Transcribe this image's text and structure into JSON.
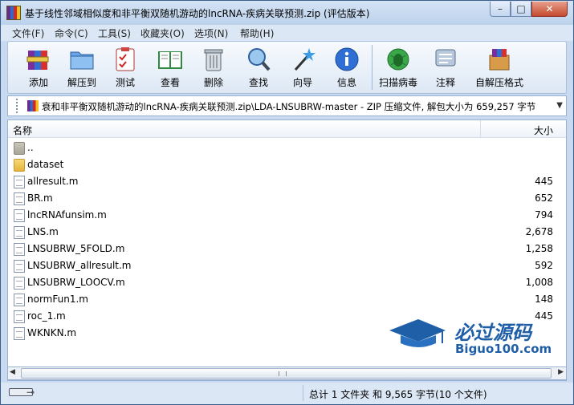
{
  "window": {
    "title": "基于线性邻域相似度和非平衡双随机游动的lncRNA-疾病关联预测.zip (评估版本)"
  },
  "title_buttons": {
    "minimize": "–",
    "maximize": "□",
    "close": "✕"
  },
  "menu": {
    "items": [
      "文件(F)",
      "命令(C)",
      "工具(S)",
      "收藏夹(O)",
      "选项(N)",
      "帮助(H)"
    ]
  },
  "toolbar": {
    "items": [
      {
        "label": "添加",
        "icon": "add-archive-icon"
      },
      {
        "label": "解压到",
        "icon": "extract-folder-icon"
      },
      {
        "label": "测试",
        "icon": "test-clipboard-icon"
      },
      {
        "label": "查看",
        "icon": "view-book-icon"
      },
      {
        "label": "删除",
        "icon": "trash-icon"
      },
      {
        "label": "查找",
        "icon": "magnifier-icon"
      },
      {
        "label": "向导",
        "icon": "wizard-wand-icon"
      },
      {
        "label": "信息",
        "icon": "info-icon"
      },
      {
        "label": "扫描病毒",
        "icon": "virus-scan-icon"
      },
      {
        "label": "注释",
        "icon": "comment-icon"
      },
      {
        "label": "自解压格式",
        "icon": "sfx-box-icon"
      }
    ]
  },
  "pathbar": {
    "text": "衰和非平衡双随机游动的lncRNA-疾病关联预测.zip\\LDA-LNSUBRW-master - ZIP 压缩文件, 解包大小为 659,257 字节",
    "dropdown": "▼"
  },
  "filelist": {
    "columns": {
      "name": "名称",
      "size": "大小"
    },
    "rows": [
      {
        "name": "..",
        "size": "",
        "type": "up"
      },
      {
        "name": "dataset",
        "size": "",
        "type": "folder"
      },
      {
        "name": "allresult.m",
        "size": "445",
        "type": "file"
      },
      {
        "name": "BR.m",
        "size": "652",
        "type": "file"
      },
      {
        "name": "lncRNAfunsim.m",
        "size": "794",
        "type": "file"
      },
      {
        "name": "LNS.m",
        "size": "2,678",
        "type": "file"
      },
      {
        "name": "LNSUBRW_5FOLD.m",
        "size": "1,258",
        "type": "file"
      },
      {
        "name": "LNSUBRW_allresult.m",
        "size": "592",
        "type": "file"
      },
      {
        "name": "LNSUBRW_LOOCV.m",
        "size": "1,008",
        "type": "file"
      },
      {
        "name": "normFun1.m",
        "size": "148",
        "type": "file"
      },
      {
        "name": "roc_1.m",
        "size": "445",
        "type": "file"
      },
      {
        "name": "WKNKN.m",
        "size": "",
        "type": "file"
      }
    ]
  },
  "watermark": {
    "title": "必过源码",
    "subtitle": "Biguo100.com"
  },
  "scrollbar": {
    "left_arrow": "◀",
    "right_arrow": "▶"
  },
  "status": {
    "text": "总计 1 文件夹 和 9,565 字节(10 个文件)",
    "key_icon": "⊸"
  },
  "colors": {
    "accent": "#1f5fa8",
    "window_bg": "#c9daf0",
    "close_red": "#c44a30"
  }
}
